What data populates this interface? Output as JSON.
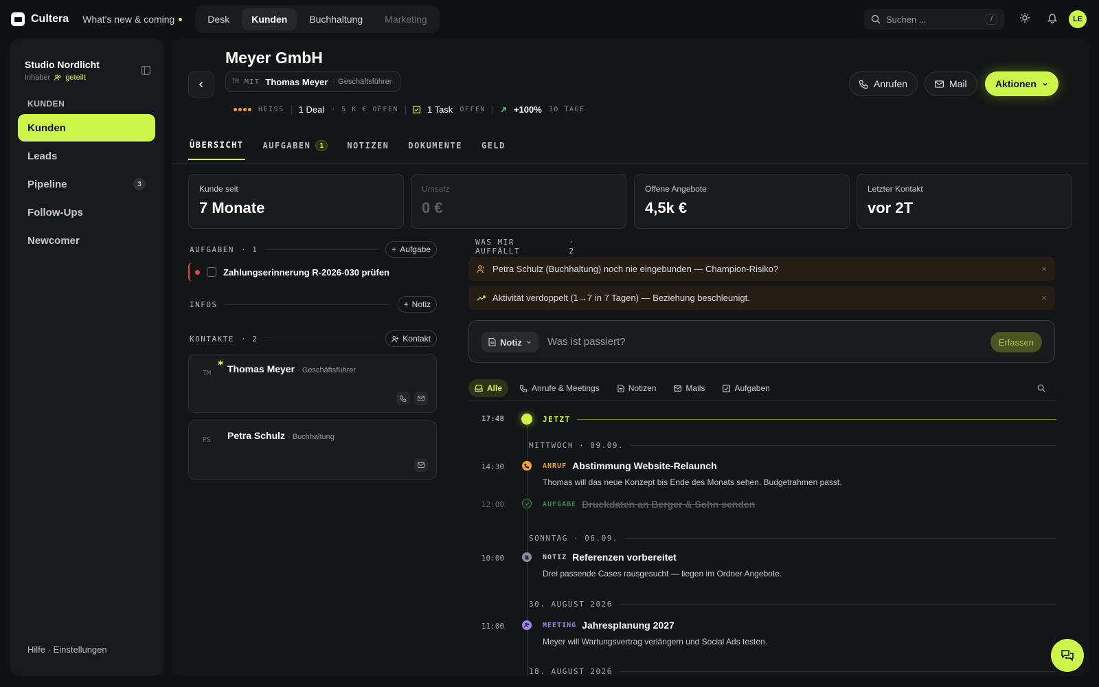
{
  "app": {
    "name": "Cultera",
    "whats_new": "What's new & coming"
  },
  "nav": {
    "tabs": [
      {
        "label": "Desk"
      },
      {
        "label": "Kunden"
      },
      {
        "label": "Buchhaltung"
      },
      {
        "label": "Marketing"
      }
    ],
    "active": "Kunden"
  },
  "search": {
    "placeholder": "Suchen ...",
    "shortcut": "/"
  },
  "user": {
    "initials": "LE"
  },
  "workspace": {
    "name": "Studio Nordlicht",
    "role": "Inhaber",
    "shared": "geteilt"
  },
  "sidebar": {
    "section": "KUNDEN",
    "items": [
      {
        "label": "Kunden",
        "active": true
      },
      {
        "label": "Leads"
      },
      {
        "label": "Pipeline",
        "badge": "3"
      },
      {
        "label": "Follow-Ups"
      },
      {
        "label": "Newcomer"
      }
    ],
    "footer": "Hilfe · Einstellungen"
  },
  "customer": {
    "name": "Meyer GmbH",
    "contact_prefix": "MIT",
    "contact_initials": "TM",
    "contact_name": "Thomas Meyer",
    "contact_role": "· Geschäftsführer",
    "heat_label": "HEISS",
    "deals": "1 Deal",
    "deals_sub": "· 5 K € OFFEN",
    "tasks": "1 Task",
    "tasks_sub": "OFFEN",
    "trend": "+100%",
    "trend_sub": "30 TAGE"
  },
  "header_actions": {
    "call": "Anrufen",
    "mail": "Mail",
    "actions": "Aktionen"
  },
  "tabs": [
    {
      "label": "ÜBERSICHT",
      "active": true
    },
    {
      "label": "AUFGABEN",
      "badge": "1"
    },
    {
      "label": "NOTIZEN"
    },
    {
      "label": "DOKUMENTE"
    },
    {
      "label": "GELD"
    }
  ],
  "stats": [
    {
      "label": "Kunde seit",
      "value": "7 Monate"
    },
    {
      "label": "Umsatz",
      "value": "0 €"
    },
    {
      "label": "Offene Angebote",
      "value": "4,5k €"
    },
    {
      "label": "Letzter Kontakt",
      "value": "vor 2T"
    }
  ],
  "aufgaben": {
    "title": "AUFGABEN",
    "count": "· 1",
    "add": "Aufgabe",
    "items": [
      {
        "title": "Zahlungserinnerung R-2026-030 prüfen"
      }
    ]
  },
  "infos": {
    "title": "INFOS",
    "add": "Notiz"
  },
  "kontakte": {
    "title": "KONTAKTE",
    "count": "· 2",
    "add": "Kontakt",
    "items": [
      {
        "initials": "TM",
        "name": "Thomas Meyer",
        "role": "· Geschäftsführer"
      },
      {
        "initials": "PS",
        "name": "Petra Schulz",
        "role": "· Buchhaltung"
      }
    ]
  },
  "insights": {
    "title": "WAS MIR AUFFÄLLT",
    "count": "· 2",
    "items": [
      {
        "text": "Petra Schulz (Buchhaltung) noch nie eingebunden — Champion-Risiko?"
      },
      {
        "text": "Aktivität verdoppelt (1→7 in 7 Tagen) — Beziehung beschleunigt."
      }
    ]
  },
  "composer": {
    "type": "Notiz",
    "placeholder": "Was ist passiert?",
    "submit": "Erfassen"
  },
  "filters": [
    {
      "label": "Alle",
      "active": true
    },
    {
      "label": "Anrufe & Meetings"
    },
    {
      "label": "Notizen"
    },
    {
      "label": "Mails"
    },
    {
      "label": "Aufgaben"
    }
  ],
  "timeline": {
    "now_time": "17:48",
    "now_label": "JETZT",
    "day_1": "MITTWOCH · 09.09.",
    "day_2": "SONNTAG · 06.09.",
    "day_3": "30. AUGUST 2026",
    "day_4": "18. AUGUST 2026",
    "events": [
      {
        "time": "14:30",
        "type": "ANRUF",
        "title": "Abstimmung Website-Relaunch",
        "desc": "Thomas will das neue Konzept bis Ende des Monats sehen. Budgetrahmen passt."
      },
      {
        "time": "12:00",
        "type": "AUFGABE",
        "title": "Druckdaten an Berger & Sohn senden",
        "desc": ""
      },
      {
        "time": "10:00",
        "type": "NOTIZ",
        "title": "Referenzen vorbereitet",
        "desc": "Drei passende Cases rausgesucht — liegen im Ordner Angebote."
      },
      {
        "time": "11:00",
        "type": "MEETING",
        "title": "Jahresplanung 2027",
        "desc": "Meyer will Wartungsvertrag verlängern und Social Ads testen."
      }
    ]
  },
  "colors": {
    "accent": "#cdf64a",
    "danger": "#e04848",
    "call": "#f0a03c",
    "task": "#3c8a4a",
    "note": "#8a8aa0",
    "meeting": "#a08ae8"
  }
}
